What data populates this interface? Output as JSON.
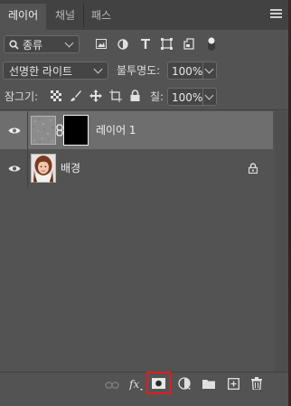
{
  "tabs": [
    {
      "label": "레이어"
    },
    {
      "label": "채널"
    },
    {
      "label": "패스"
    }
  ],
  "filter": {
    "kind_label": "종류"
  },
  "blend": {
    "mode_label": "선명한 라이트",
    "opacity_label": "불투명도:",
    "opacity_value": "100%"
  },
  "lock": {
    "label": "잠그기:",
    "fill_label": "칠:",
    "fill_value": "100%"
  },
  "layers": [
    {
      "name": "레이어 1",
      "selected": true
    },
    {
      "name": "배경",
      "locked": true
    }
  ],
  "colors": {
    "panel_bg": "#535353",
    "tabbar_bg": "#424242",
    "selected_row": "#6e6e6e",
    "highlight": "#e41c1c"
  },
  "icons": {
    "bottom": [
      "link-icon",
      "fx-icon",
      "add-mask-icon",
      "adjustment-icon",
      "folder-icon",
      "new-layer-icon",
      "trash-icon"
    ]
  }
}
